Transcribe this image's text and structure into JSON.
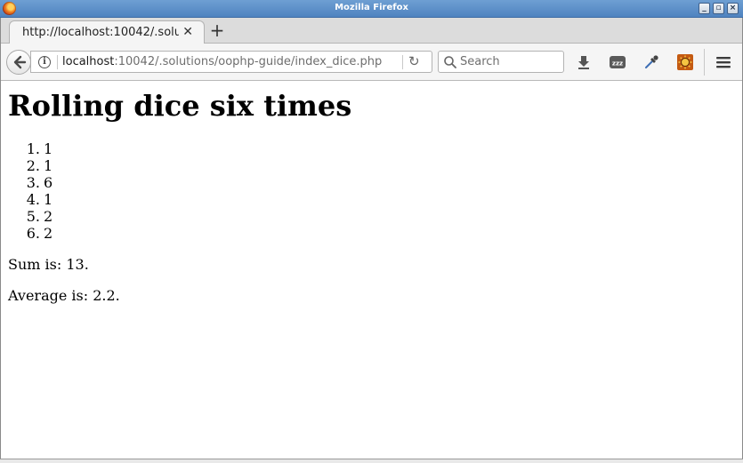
{
  "window": {
    "title": "Mozilla Firefox"
  },
  "tabs": [
    {
      "title": "http://localhost:10042/.solutions/oophp-guide/index_dice.php",
      "active": true
    }
  ],
  "navigation": {
    "url_host": "localhost",
    "url_path": ":10042/.solutions/oophp-guide/index_dice.php",
    "search_placeholder": "Search"
  },
  "toolbar_icons": [
    "back-arrow-icon",
    "info-icon",
    "reload-icon",
    "search-icon",
    "download-icon",
    "sleep-zzz-icon",
    "eyedropper-icon",
    "extension-sun-icon",
    "hamburger-menu-icon"
  ],
  "page": {
    "heading": "Rolling dice six times",
    "rolls": [
      {
        "num": "1.",
        "value": "1"
      },
      {
        "num": "2.",
        "value": "1"
      },
      {
        "num": "3.",
        "value": "6"
      },
      {
        "num": "4.",
        "value": "1"
      },
      {
        "num": "5.",
        "value": "2"
      },
      {
        "num": "6.",
        "value": "2"
      }
    ],
    "sum_text": "Sum is: 13.",
    "average_text": "Average is: 2.2."
  },
  "colors": {
    "titlebar": "#5b8fcb",
    "url_host": "#1a1a1a",
    "url_path": "#6e6e6e"
  }
}
